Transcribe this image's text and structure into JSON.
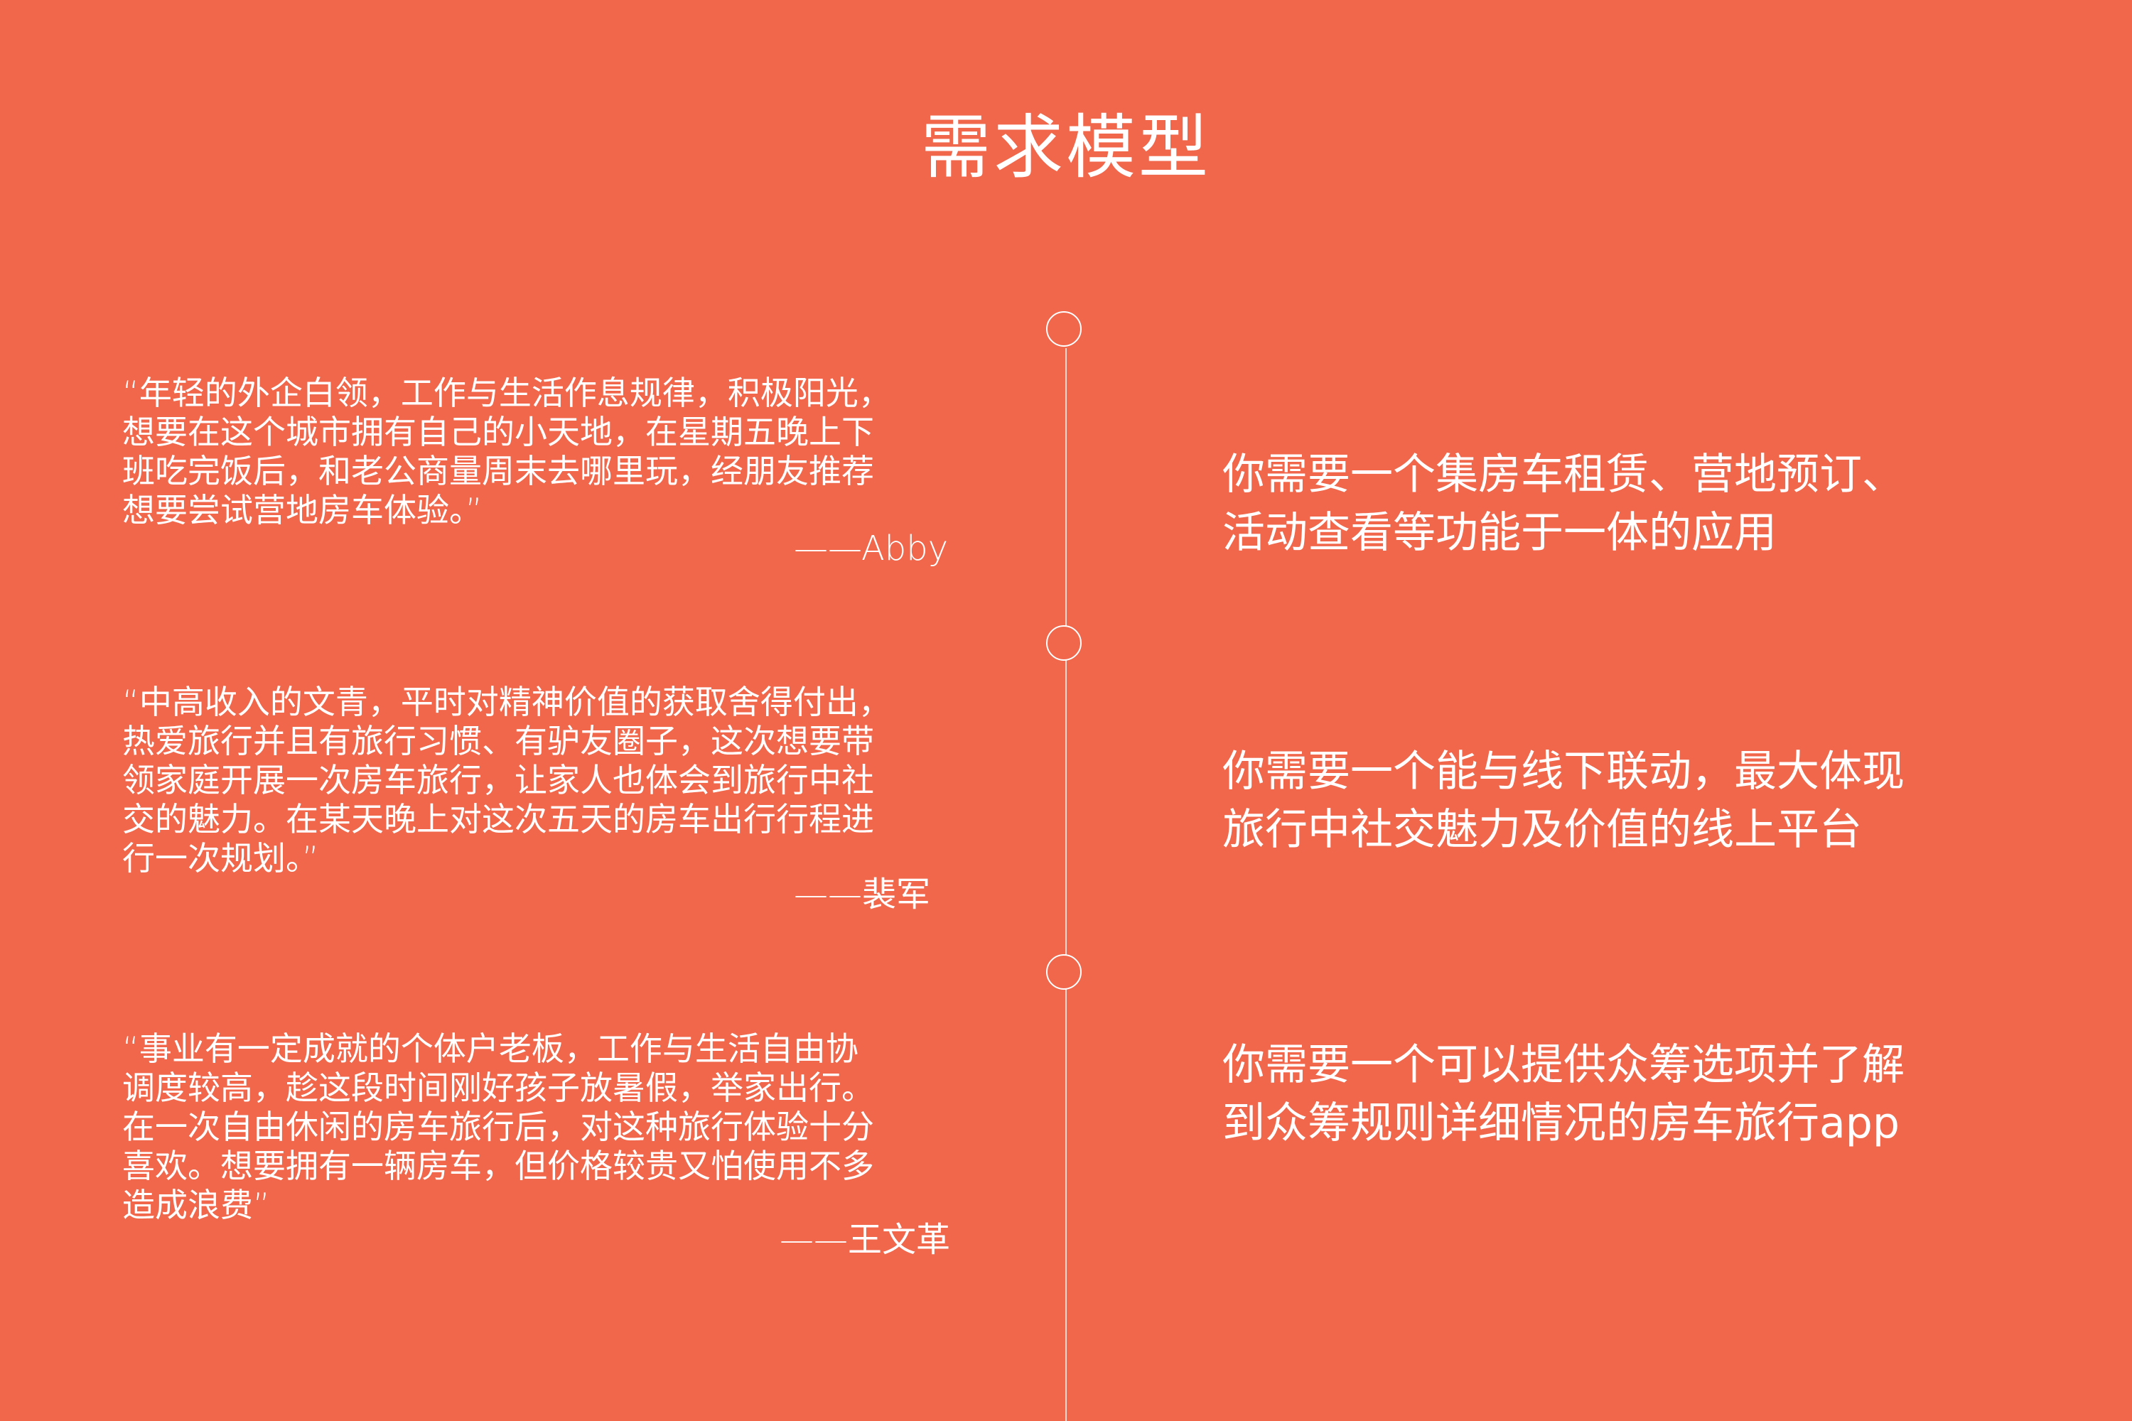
{
  "title": "需求模型",
  "personas": [
    {
      "quote": "“年轻的外企白领，工作与生活作息规律，积极阳光，\n想要在这个城市拥有自己的小天地，在星期五晚上下\n班吃完饭后，和老公商量周末去哪里玩，经朋友推荐\n想要尝试营地房车体验。”",
      "attribution": "——Abby",
      "need": "你需要一个集房车租赁、营地预订、\n活动查看等功能于一体的应用"
    },
    {
      "quote": "“中高收入的文青，平时对精神价值的获取舍得付出，\n热爱旅行并且有旅行习惯、有驴友圈子，这次想要带\n领家庭开展一次房车旅行，让家人也体会到旅行中社\n交的魅力。在某天晚上对这次五天的房车出行行程进\n行一次规划。”",
      "attribution": "——裴军",
      "need": "你需要一个能与线下联动，最大体现\n旅行中社交魅力及价值的线上平台"
    },
    {
      "quote": "“事业有一定成就的个体户老板，工作与生活自由协\n调度较高，趁这段时间刚好孩子放暑假，举家出行。\n在一次自由休闲的房车旅行后，对这种旅行体验十分\n喜欢。想要拥有一辆房车，但价格较贵又怕使用不多\n造成浪费”",
      "attribution": "——王文革",
      "need": "你需要一个可以提供众筹选项并了解\n到众筹规则详细情况的房车旅行app"
    }
  ]
}
